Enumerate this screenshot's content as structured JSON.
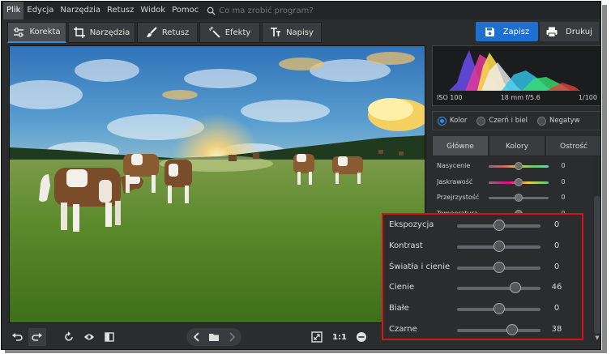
{
  "menu": {
    "items": [
      "Plik",
      "Edycja",
      "Narzędzia",
      "Retusz",
      "Widok",
      "Pomoc"
    ],
    "search_placeholder": "Co ma zrobić program?"
  },
  "tabs": [
    {
      "label": "Korekta",
      "icon": "sliders-icon"
    },
    {
      "label": "Narzędzia",
      "icon": "crop-icon"
    },
    {
      "label": "Retusz",
      "icon": "brush-icon"
    },
    {
      "label": "Efekty",
      "icon": "magic-wand-icon"
    },
    {
      "label": "Napisy",
      "icon": "text-icon"
    }
  ],
  "actions": {
    "save_label": "Zapisz",
    "print_label": "Drukuj"
  },
  "histogram": {
    "iso": "ISO 100",
    "lens": "18 mm f/5.6",
    "shutter": "1/100"
  },
  "color_mode": {
    "options": [
      "Kolor",
      "Czerń i biel",
      "Negatyw"
    ],
    "selected": "Kolor"
  },
  "panel_tabs": [
    "Główne",
    "Kolory",
    "Ostrość"
  ],
  "panel_sliders": [
    {
      "label": "Nasycenie",
      "value": "0",
      "level": 0.5
    },
    {
      "label": "Jaskrawość",
      "value": "0",
      "level": 0.5
    },
    {
      "label": "Przejrzystość",
      "value": "0",
      "level": 0.5
    },
    {
      "label": "Temperatura",
      "value": "0",
      "level": 0.5
    }
  ],
  "highlight_sliders": [
    {
      "label": "Ekspozycja",
      "value": "0",
      "level": 0.5
    },
    {
      "label": "Kontrast",
      "value": "0",
      "level": 0.5
    },
    {
      "label": "Światła i cienie",
      "value": "0",
      "level": 0.5
    },
    {
      "label": "Cienie",
      "value": "46",
      "level": 0.7
    },
    {
      "label": "Białe",
      "value": "0",
      "level": 0.5
    },
    {
      "label": "Czarne",
      "value": "38",
      "level": 0.66
    }
  ],
  "bottom": {
    "zoom_label": "1:1"
  },
  "colors": {
    "accent": "#2f8de4",
    "save_button": "#1e6fd0",
    "highlight_border": "#d8121a"
  }
}
